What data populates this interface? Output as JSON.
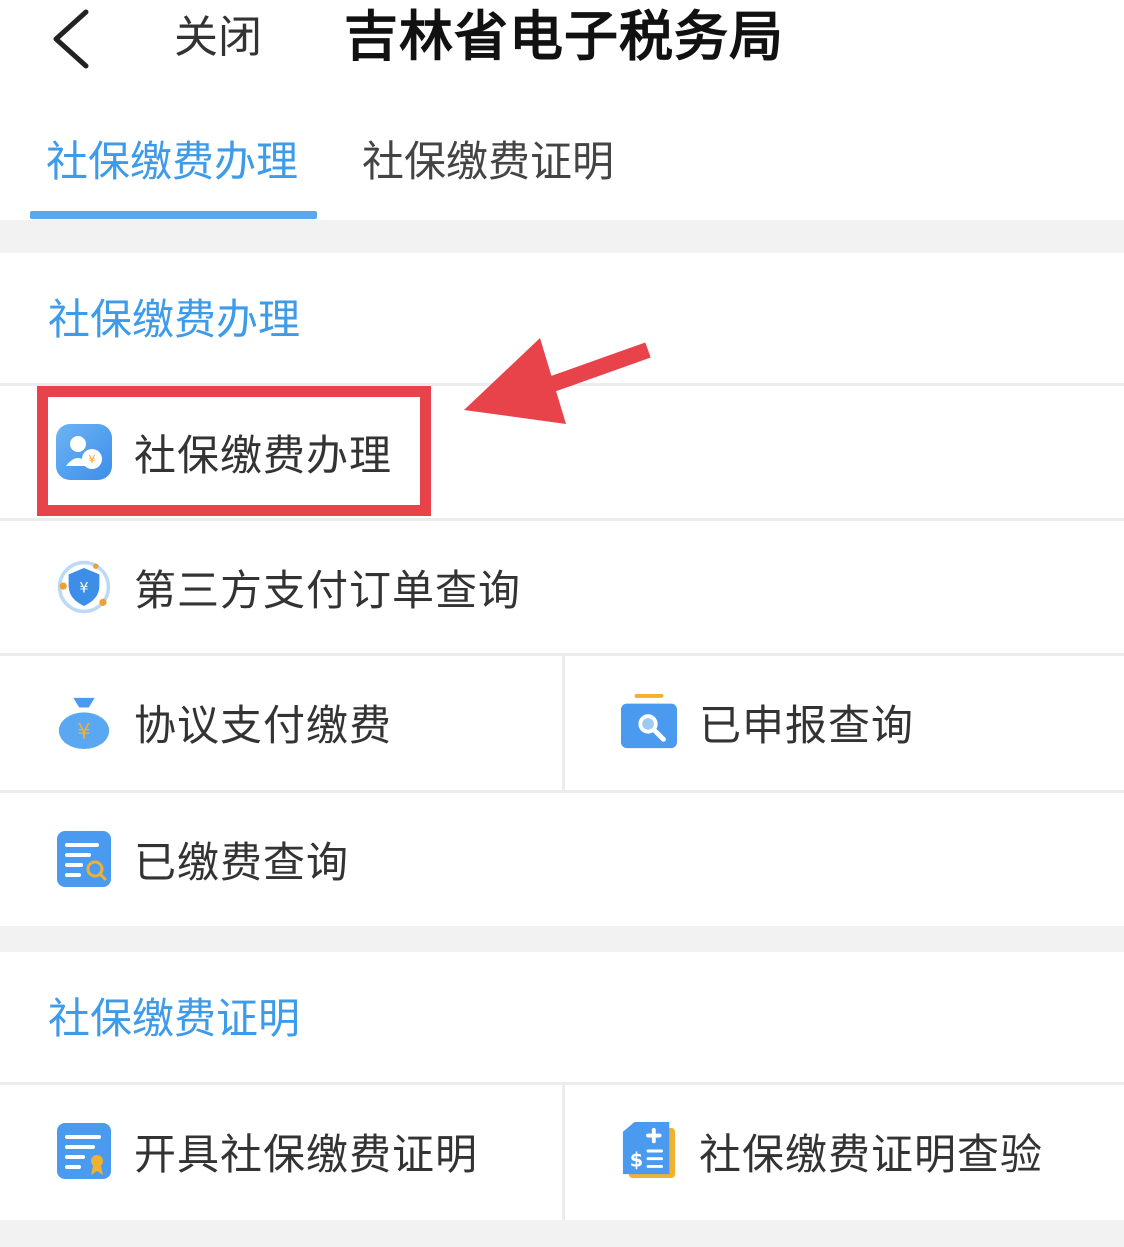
{
  "header": {
    "close_label": "关闭",
    "title": "吉林省电子税务局"
  },
  "tabs": [
    {
      "label": "社保缴费办理",
      "active": true
    },
    {
      "label": "社保缴费证明",
      "active": false
    }
  ],
  "section1": {
    "title": "社保缴费办理",
    "items": [
      {
        "label": "社保缴费办理",
        "icon": "person-yuan-icon"
      },
      {
        "label": "第三方支付订单查询",
        "icon": "shield-yuan-icon"
      },
      {
        "label": "协议支付缴费",
        "icon": "money-bag-icon"
      },
      {
        "label": "已申报查询",
        "icon": "folder-search-icon"
      },
      {
        "label": "已缴费查询",
        "icon": "document-search-icon"
      }
    ]
  },
  "section2": {
    "title": "社保缴费证明",
    "items": [
      {
        "label": "开具社保缴费证明",
        "icon": "certificate-icon"
      },
      {
        "label": "社保缴费证明查验",
        "icon": "document-dollar-icon"
      }
    ]
  },
  "colors": {
    "accent": "#3d9be9",
    "annotation_red": "#e8434a",
    "text": "#333333"
  }
}
